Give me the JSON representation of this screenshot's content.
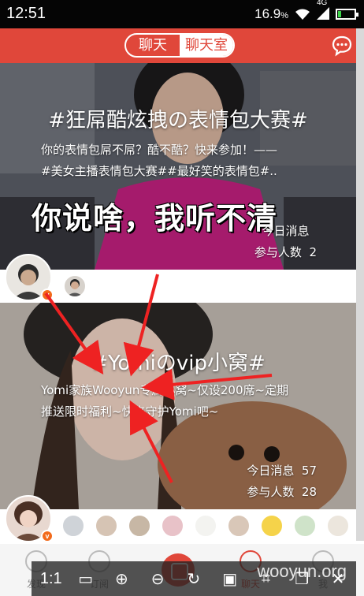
{
  "status_bar": {
    "time": "12:51",
    "battery_text": "16.9",
    "battery_unit": "%",
    "network": "4G",
    "battery_level": 0.169
  },
  "header": {
    "tabs": [
      {
        "label": "聊天",
        "active": false
      },
      {
        "label": "聊天室",
        "active": true
      }
    ],
    "action_icon": "chat-bubble-icon"
  },
  "rooms": [
    {
      "title": "#狂屌酷炫拽の表情包大赛#",
      "description": [
        "你的表情包屌不屌？酷不酷？快来参加！——",
        "#美女主播表情包大赛##最好笑的表情包#.."
      ],
      "caption": "你说啥，我听不清",
      "today_messages_label": "今日消息",
      "today_messages_value": "",
      "participants_label": "参与人数",
      "participants_value": "2"
    },
    {
      "title": "#Yomiのvip小窝#",
      "description": [
        "Yomi家族Wooyun专属小窝~仅设200席~定期",
        "推送限时福利~快来守护Yomi吧~"
      ],
      "today_messages_label": "今日消息",
      "today_messages_value": "57",
      "participants_label": "参与人数",
      "participants_value": "28"
    }
  ],
  "owner_badge": "v",
  "bottom_nav": {
    "items": [
      "发现",
      "订阅",
      "",
      "聊天",
      "我"
    ]
  },
  "viewer_toolbar": {
    "zoom_label": "1:1",
    "watermark": "wooyun.org"
  },
  "colors": {
    "accent": "#e0473a",
    "badge": "#f26a1b",
    "annotation_arrow": "#ee2222"
  }
}
